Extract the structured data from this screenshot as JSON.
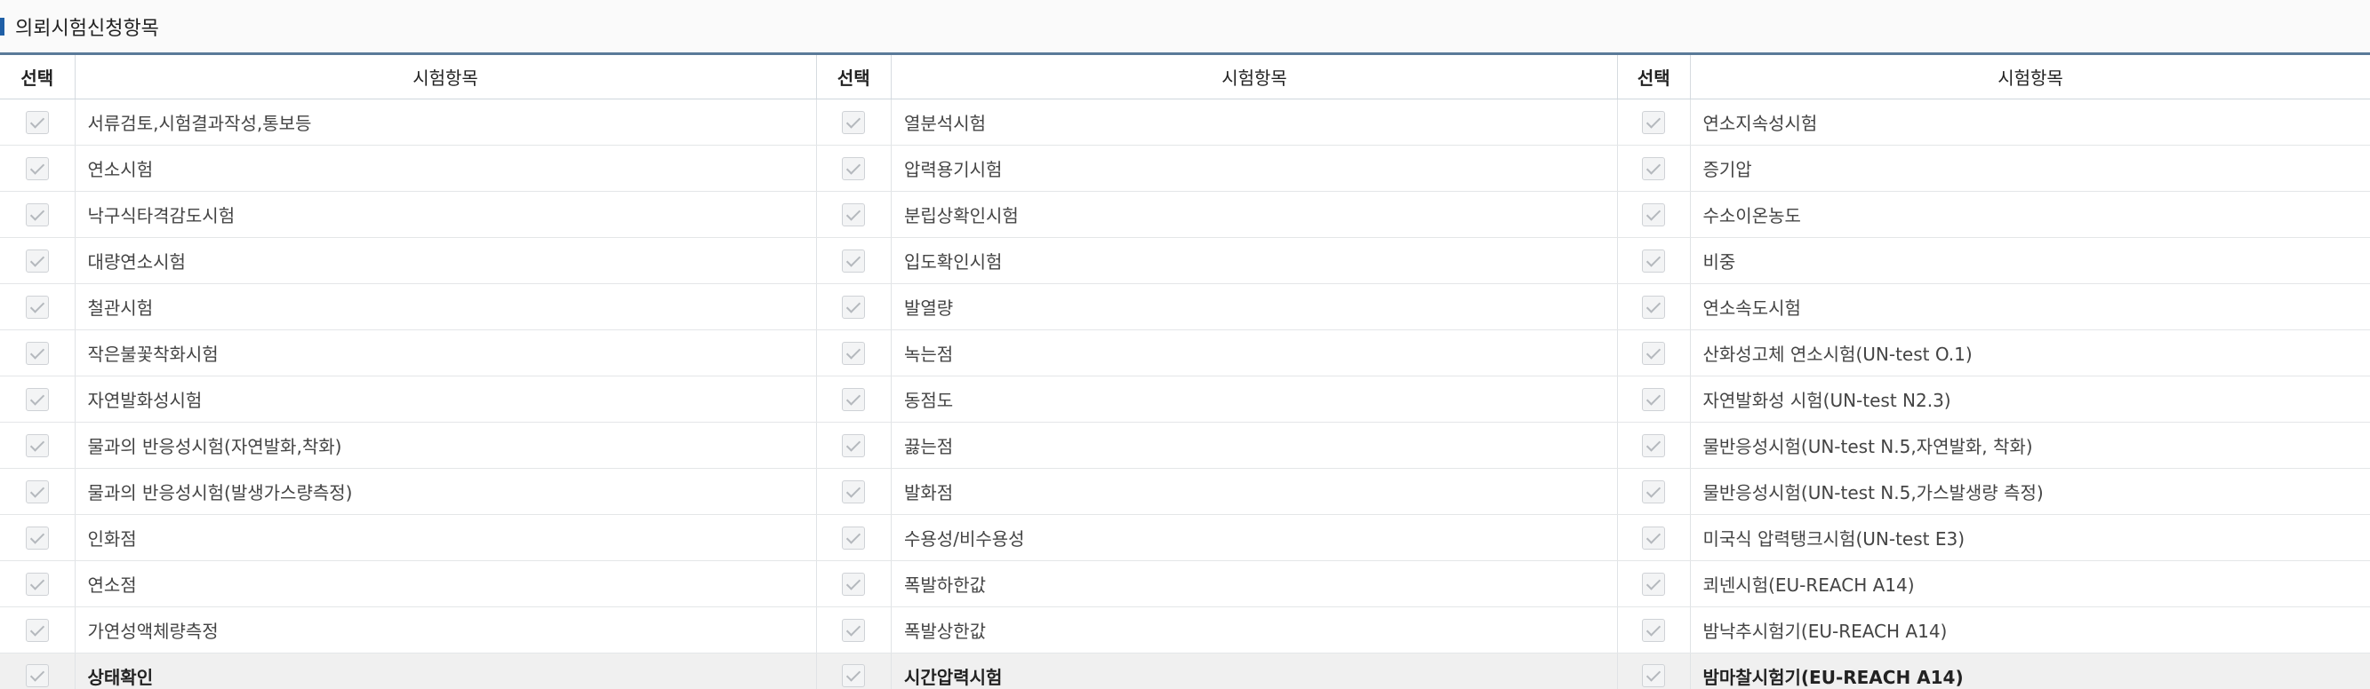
{
  "section": {
    "title": "의뢰시험신청항목"
  },
  "headers": {
    "select": "선택",
    "item": "시험항목"
  },
  "columns": [
    {
      "items": [
        "서류검토,시험결과작성,통보등",
        "연소시험",
        "낙구식타격감도시험",
        "대량연소시험",
        "철관시험",
        "작은불꽃착화시험",
        "자연발화성시험",
        "물과의 반응성시험(자연발화,착화)",
        "물과의 반응성시험(발생가스량측정)",
        "인화점",
        "연소점",
        "가연성액체량측정",
        "상태확인"
      ]
    },
    {
      "items": [
        "열분석시험",
        "압력용기시험",
        "분립상확인시험",
        "입도확인시험",
        "발열량",
        "녹는점",
        "동점도",
        "끓는점",
        "발화점",
        "수용성/비수용성",
        "폭발하한값",
        "폭발상한값",
        "시간압력시험"
      ]
    },
    {
      "items": [
        "연소지속성시험",
        "증기압",
        "수소이온농도",
        "비중",
        "연소속도시험",
        "산화성고체 연소시험(UN-test O.1)",
        "자연발화성 시험(UN-test N2.3)",
        "물반응성시험(UN-test N.5,자연발화, 착화)",
        "물반응성시험(UN-test N.5,가스발생량 측정)",
        "미국식 압력탱크시험(UN-test E3)",
        "쾨넨시험(EU-REACH A14)",
        "밤낙추시험기(EU-REACH A14)",
        "밤마찰시험기(EU-REACH A14)"
      ]
    }
  ]
}
